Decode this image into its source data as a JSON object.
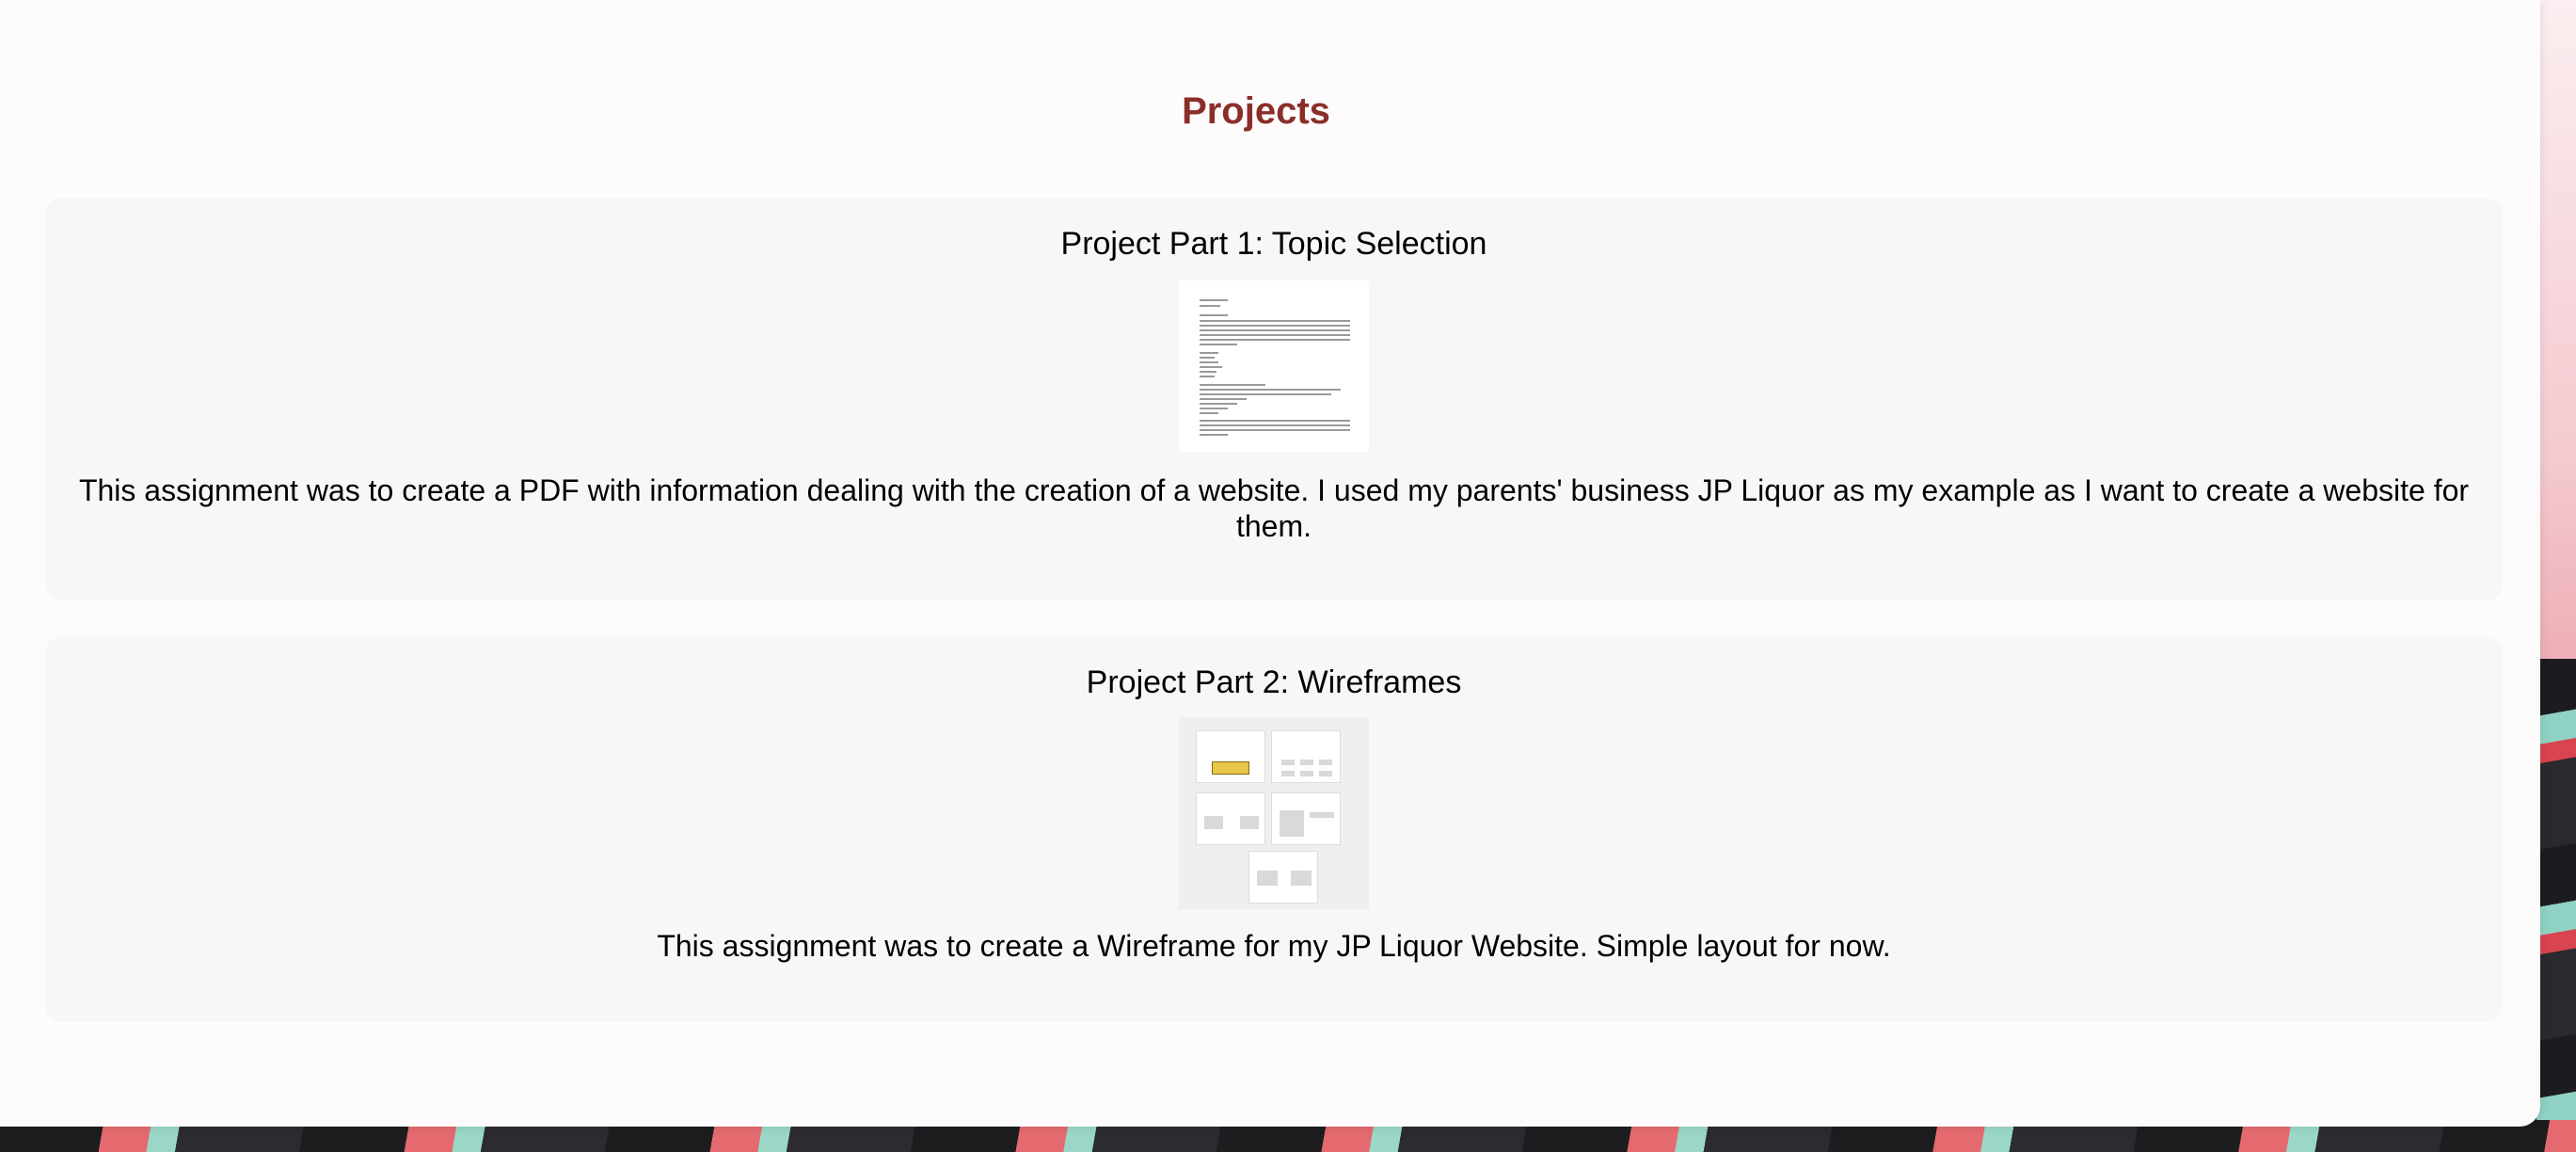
{
  "section": {
    "title": "Projects"
  },
  "projects": [
    {
      "title": "Project Part 1: Topic Selection",
      "thumbnail_alt": "topic selection document preview",
      "description": "This assignment was to create a PDF with information dealing with the creation of a website. I used my parents' business JP Liquor as my example as I want to create a website for them."
    },
    {
      "title": "Project Part 2: Wireframes",
      "thumbnail_alt": "wireframes preview",
      "description": "This assignment was to create a Wireframe for my JP Liquor Website. Simple layout for now."
    }
  ],
  "colors": {
    "heading": "#8b2e2a",
    "card_bg": "#f7f7f7",
    "panel_bg": "#fdfbfb"
  }
}
